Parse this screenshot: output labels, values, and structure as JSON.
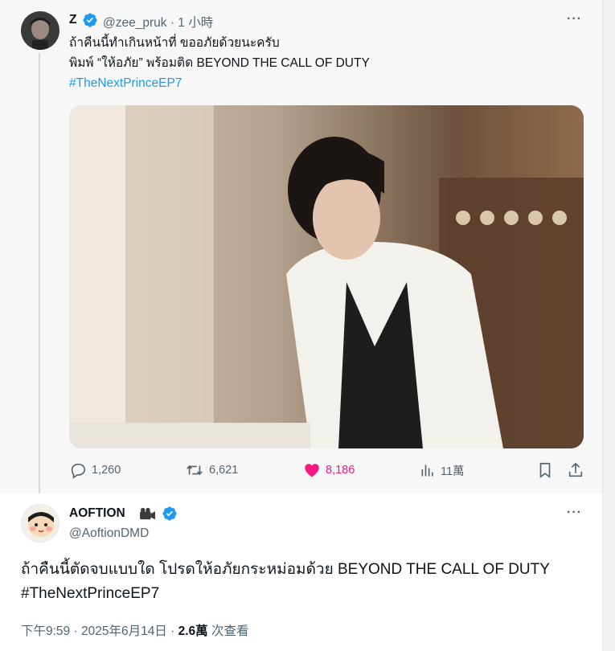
{
  "parent": {
    "name": "Z",
    "handle": "@zee_pruk",
    "separator": "·",
    "time": "1 小時",
    "more": "···",
    "lines": [
      "ถ้าคืนนี้ทำเกินหน้าที่ ขออภัยด้วยนะครับ",
      "พิมพ์ “ให้อภัย” พร้อมติด BEYOND THE CALL OF DUTY"
    ],
    "hashtag": "#TheNextPrinceEP7",
    "actions": {
      "replies": "1,260",
      "reposts": "6,621",
      "likes": "8,186",
      "views": "11萬"
    }
  },
  "reply": {
    "name": "AOFTION",
    "handle": "@AoftionDMD",
    "more": "···",
    "text": "ถ้าคืนนี้ตัดจบแบบใด โปรดให้อภัยกระหม่อมด้วย BEYOND THE CALL OF DUTY",
    "hashtag": "#TheNextPrinceEP7",
    "meta": {
      "time": "下午9:59",
      "date": "2025年6月14日",
      "views": "2.6萬",
      "views_label": "次查看",
      "separator": "·"
    }
  },
  "colors": {
    "accent": "#1d9bf0",
    "like": "#f91880",
    "muted": "#536471",
    "text": "#0f1419"
  },
  "icons": [
    "verified-badge-icon",
    "more-icon",
    "reply-icon",
    "repost-icon",
    "heart-icon",
    "views-icon",
    "bookmark-icon",
    "share-icon",
    "camera-emoji-icon"
  ]
}
